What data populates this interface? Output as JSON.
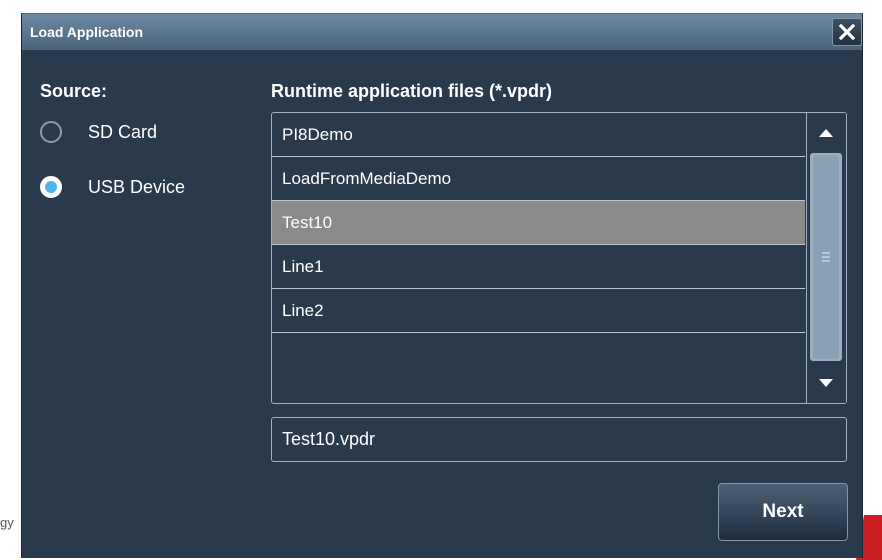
{
  "dialog": {
    "title": "Load Application"
  },
  "source": {
    "label": "Source:",
    "options": [
      {
        "label": "SD Card",
        "checked": false
      },
      {
        "label": "USB Device",
        "checked": true
      }
    ]
  },
  "files": {
    "label": "Runtime application files (*.vpdr)",
    "items": [
      "PI8Demo",
      "LoadFromMediaDemo",
      "Test10",
      "Line1",
      "Line2"
    ],
    "selected": "Test10"
  },
  "filename": {
    "value": "Test10.vpdr"
  },
  "buttons": {
    "next_label": "Next"
  },
  "background": {
    "fragment_text": "gy"
  },
  "colors": {
    "dialog_bg": "#2a3a4d",
    "titlebar": "#5b7690",
    "selected_row": "#8a8a8a",
    "radio_accent": "#4db4f0",
    "brand_red": "#cc2026"
  },
  "icons": {
    "close": "close-icon",
    "scroll_up": "arrow-up-icon",
    "scroll_down": "arrow-down-icon",
    "scroll_grip": "grip-lines-icon"
  }
}
